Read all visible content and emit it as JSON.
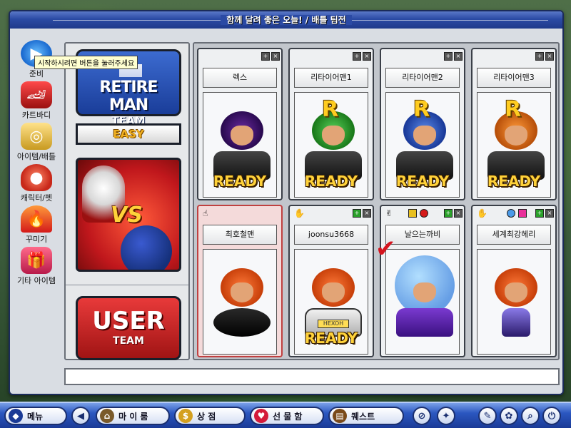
{
  "window": {
    "title": "함께 달려 좋은 오늘! / 배틀 팀전"
  },
  "tooltip": "시작하시려면 버튼을 눌러주세요",
  "sidebar": {
    "items": [
      {
        "label": "준비",
        "icon": "play-icon"
      },
      {
        "label": "카트바디",
        "icon": "kart-icon"
      },
      {
        "label": "아이템/배틀",
        "icon": "goggles-icon"
      },
      {
        "label": "캐릭터/펫",
        "icon": "mushroom-icon"
      },
      {
        "label": "꾸미기",
        "icon": "flame-icon"
      },
      {
        "label": "기타 아이템",
        "icon": "gift-box-icon"
      }
    ]
  },
  "teams": {
    "retire": {
      "line1": "RETIRE MAN",
      "line2": "TEAM"
    },
    "difficulty": "EASY",
    "vs": "VS",
    "user": {
      "line1": "USER",
      "line2": "TEAM"
    }
  },
  "slots": {
    "ai": [
      {
        "name": "렉스",
        "status": "READY"
      },
      {
        "name": "리타이어맨1",
        "status": "READY"
      },
      {
        "name": "리타이어맨2",
        "status": "READY"
      },
      {
        "name": "리타이어맨3",
        "status": "READY"
      }
    ],
    "users": [
      {
        "name": "최호철맨",
        "status": ""
      },
      {
        "name": "joonsu3668",
        "status": "READY"
      },
      {
        "name": "날으는까비",
        "status": ""
      },
      {
        "name": "세계최강헤리",
        "status": ""
      }
    ]
  },
  "kart_plate": "HEXOH",
  "colors": {
    "blue_team": "#1a3d99",
    "red_team": "#a01414",
    "ready_text": "#ffd23a",
    "taskbar": "#2b57c0"
  },
  "taskbar": {
    "menu_label": "메뉴",
    "myroom_label": "마 이 룸",
    "shop_label": "상 점",
    "gift_label": "선 물 함",
    "quest_label": "퀘스트"
  }
}
